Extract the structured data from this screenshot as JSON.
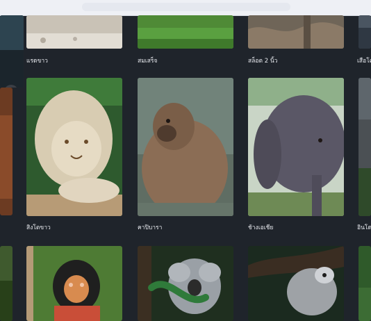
{
  "row1": {
    "white_rhino": "แรดขาว",
    "meerkat": "สมเสร็จ",
    "sloth": "สล็อต 2 นิ้ว",
    "tiger_partial": "เสือโคร่"
  },
  "row2": {
    "white_lion": "สิงโตขาว",
    "capybara": "คาปิบารา",
    "asian_elephant": "ช้างเอเชีย",
    "partial_right": "อินโดน"
  },
  "colors": {
    "background": "#1f242b",
    "text": "#e7e9ee"
  },
  "icons": [
    "play-icon"
  ]
}
